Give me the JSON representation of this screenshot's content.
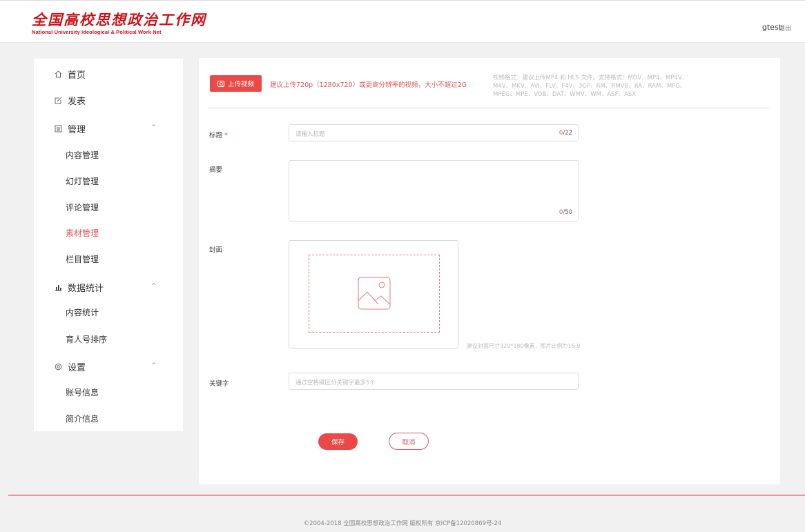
{
  "header": {
    "logo_cn": "全国高校思想政治工作网",
    "logo_en": "National University Ideological & Political Work Net",
    "username": "gtest",
    "logout": "退出"
  },
  "sidebar": {
    "home": "首页",
    "publish": "发表",
    "manage": "管理",
    "manage_items": [
      "内容管理",
      "幻灯管理",
      "评论管理",
      "素材管理",
      "栏目管理"
    ],
    "stats": "数据统计",
    "stats_items": [
      "内容统计",
      "育人号排序"
    ],
    "settings": "设置",
    "settings_items": [
      "账号信息",
      "简介信息"
    ],
    "active_item": "素材管理"
  },
  "upload": {
    "button": "上传视频",
    "tip": "建议上传720p（1280x720）或更高分辨率的视频，大小不超过2G",
    "format_tip": "视频格式：建议上传MP4 和 HLS 文件。支持格式：MOV、MP4、MP4V、M4V、MKV、AVI、FLV、F4V、3GP、RM、RMVB、RA、RAM、MPG、MPEG、MPE、VOB、DAT、WMV、WM、ASF、ASX"
  },
  "form": {
    "title_label": "标题",
    "title_required": "*",
    "title_placeholder": "请输入标题",
    "title_count": "0",
    "title_max": "/22",
    "summary_label": "摘要",
    "summary_count": "0",
    "summary_max": "/50",
    "cover_label": "封面",
    "cover_tip": "建议封面尺寸320*180像素，图片比例为16:9",
    "keywords_label": "关键字",
    "keywords_placeholder": "通过空格键区分关键字最多5个"
  },
  "actions": {
    "save": "保存",
    "cancel": "取消"
  },
  "footer": {
    "copyright": "©2004-2018 全国高校思想政治工作网 版权所有 京ICP备12020869号-24"
  },
  "colors": {
    "accent": "#e94a48",
    "brand": "#c8161d"
  }
}
